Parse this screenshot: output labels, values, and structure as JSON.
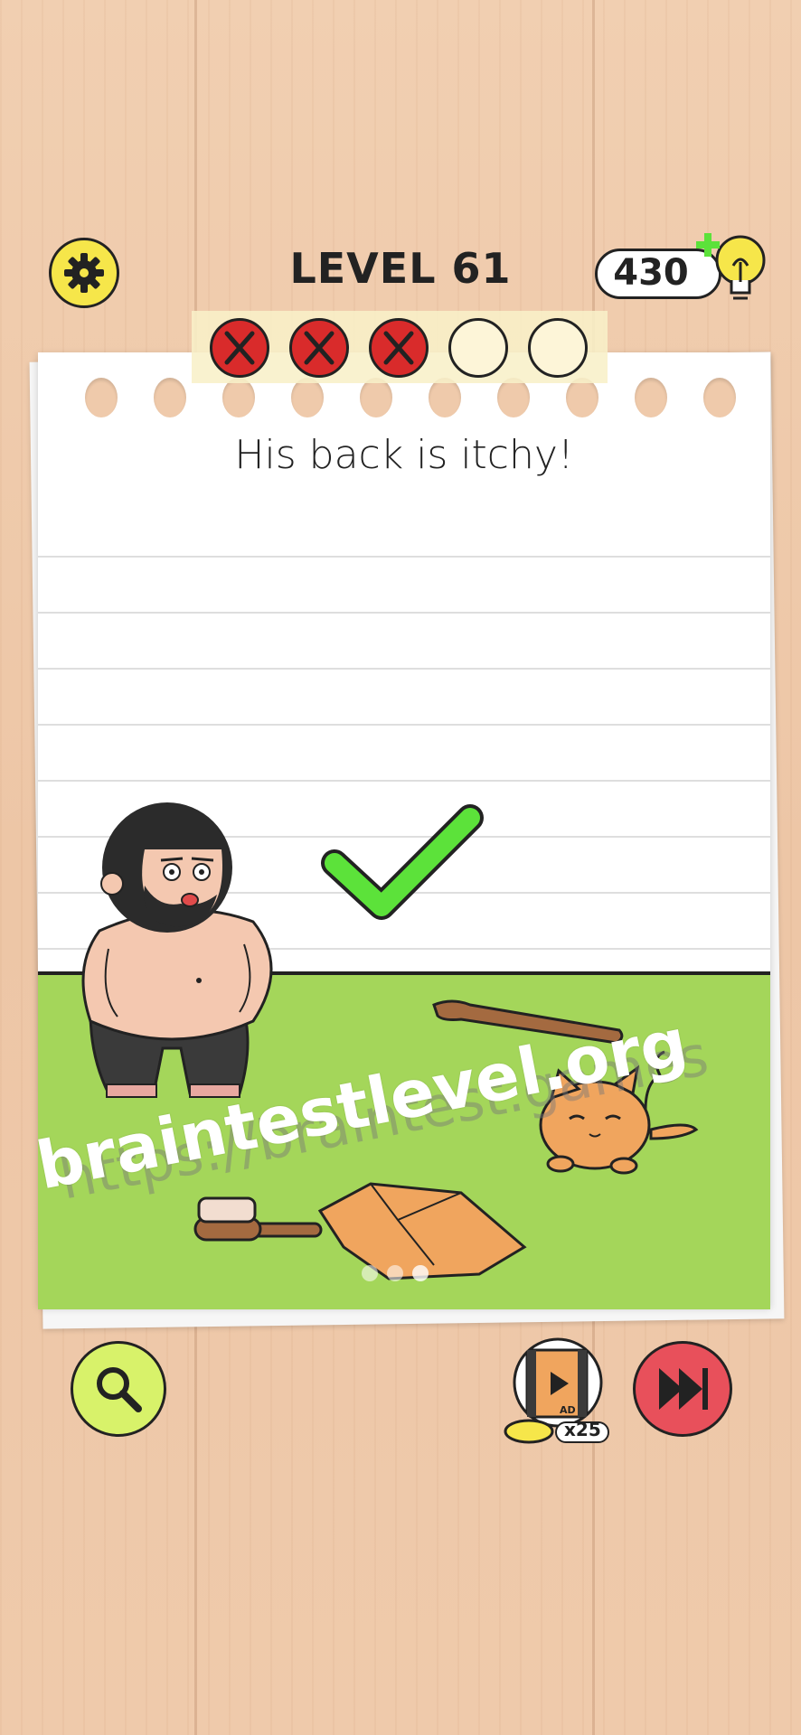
{
  "header": {
    "level_label": "LEVEL 61",
    "hint_points": "430"
  },
  "attempts": {
    "failed": 3,
    "total": 5
  },
  "puzzle": {
    "question": "His back is itchy!",
    "page_indicator": {
      "pages": 3,
      "current": 3
    }
  },
  "watermarks": {
    "brand": "braintestlevel.org",
    "url": "https://braintest.games"
  },
  "footer": {
    "ad_reward": "x25",
    "ad_label": "AD"
  },
  "colors": {
    "ground": "#a4d65a",
    "settings": "#f6e64a",
    "hint_button": "#d8f26a",
    "skip_button": "#e8505b",
    "fail_mark": "#d92b2b",
    "check": "#5ce23a"
  },
  "icons": {
    "settings": "gear-icon",
    "hint": "magnifier-icon",
    "skip": "fast-forward-icon",
    "bulb": "lightbulb-plus-icon",
    "ad": "film-play-icon"
  }
}
